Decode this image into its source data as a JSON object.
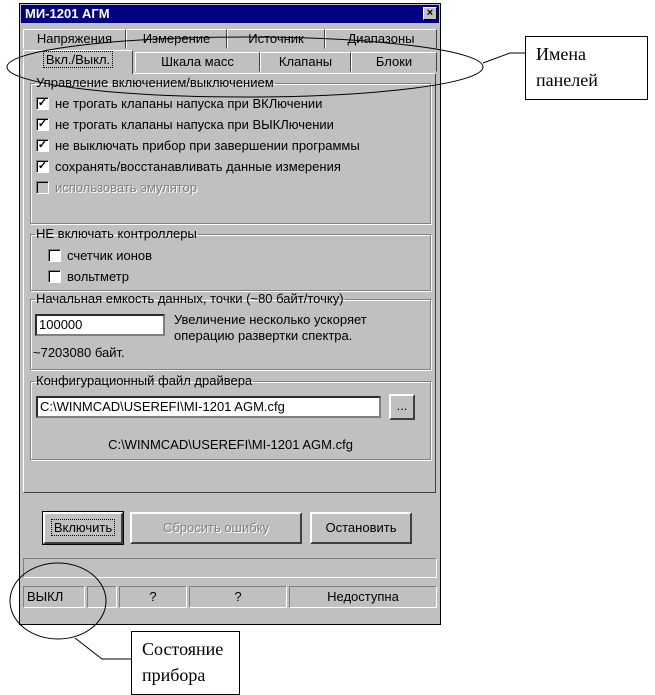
{
  "window": {
    "title": "МИ-1201 АГМ",
    "close_glyph": "×"
  },
  "tabs_row1": [
    {
      "label": "Напряжения"
    },
    {
      "label": "Измерение"
    },
    {
      "label": "Источник"
    },
    {
      "label": "Диапазоны"
    }
  ],
  "tabs_row2": [
    {
      "label": "Вкл./Выкл.",
      "active": true
    },
    {
      "label": "Шкала масс"
    },
    {
      "label": "Клапаны"
    },
    {
      "label": "Блоки"
    }
  ],
  "power_group": {
    "legend": "Управление включением/выключением",
    "items": [
      {
        "label": "не трогать клапаны напуска при ВКЛючении",
        "checked": true,
        "enabled": true
      },
      {
        "label": "не трогать клапаны напуска при ВЫКЛючении",
        "checked": true,
        "enabled": true
      },
      {
        "label": "не выключать прибор при завершении программы",
        "checked": true,
        "enabled": true
      },
      {
        "label": "сохранять/восстанавливать данные измерения",
        "checked": true,
        "enabled": true
      },
      {
        "label": "использовать эмулятор",
        "checked": false,
        "enabled": false
      }
    ]
  },
  "controllers_group": {
    "legend": "НЕ включать контроллеры",
    "items": [
      {
        "label": "счетчик ионов",
        "checked": false
      },
      {
        "label": "вольтметр",
        "checked": false
      }
    ]
  },
  "capacity_group": {
    "legend": "Начальная емкость данных, точки (~80 байт/точку)",
    "value": "100000",
    "hint": "Увеличение несколько ускоряет операцию развертки спектра.",
    "bytes": "~7203080 байт."
  },
  "config_group": {
    "legend": "Конфигурационный файл драйвера",
    "path_value": "C:\\WINMCAD\\USEREFI\\MI-1201 AGM.cfg",
    "browse_label": "...",
    "path_display": "C:\\WINMCAD\\USEREFI\\MI-1201 AGM.cfg"
  },
  "buttons": {
    "enable": "Включить",
    "reset_error": "Сбросить ошибку",
    "stop": "Остановить"
  },
  "status": {
    "state": "ВЫКЛ",
    "cell2": "",
    "cell3": "?",
    "cell4": "?",
    "availability": "Недоступна"
  },
  "callouts": {
    "panel_names": "Имена панелей",
    "device_state": "Состояние прибора"
  },
  "colors": {
    "titlebar": "#000080",
    "face": "#c0c0c0"
  }
}
